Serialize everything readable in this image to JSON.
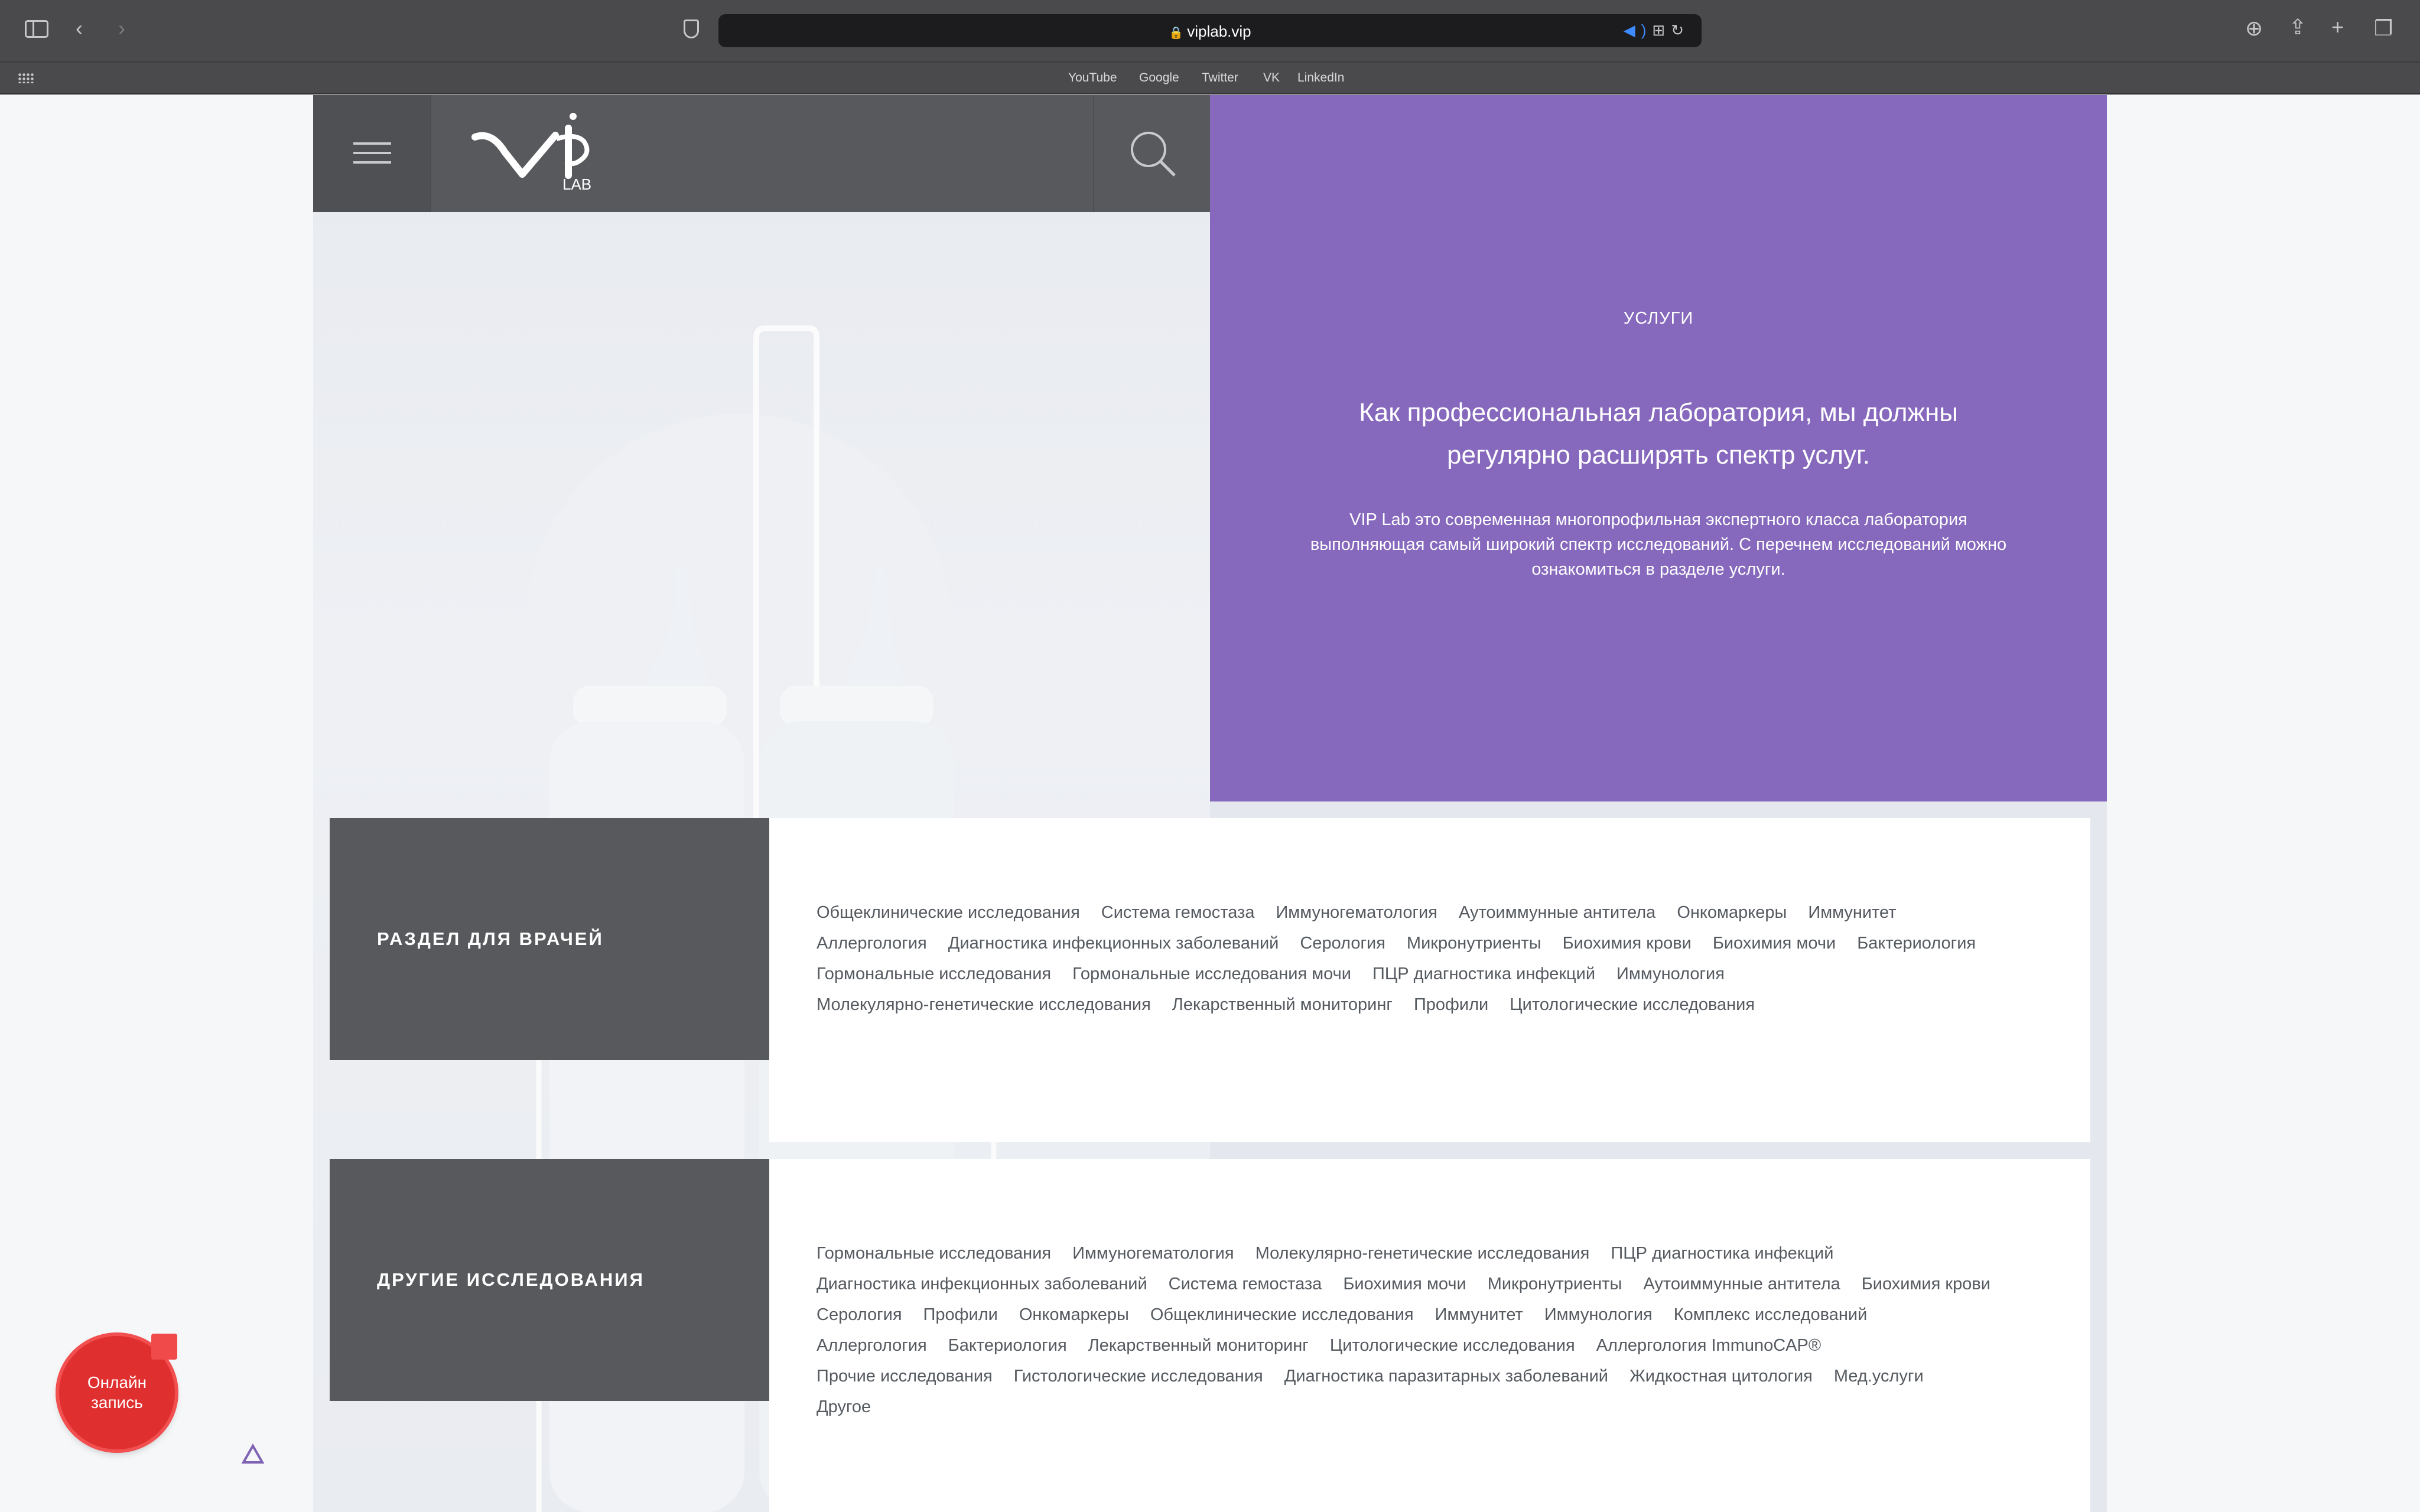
{
  "browser": {
    "url": "viplab.vip",
    "favorites": [
      "YouTube",
      "Google",
      "Twitter",
      "VK",
      "LinkedIn"
    ]
  },
  "header": {
    "logo_sub": "LAB"
  },
  "hero": {
    "label": "УСЛУГИ",
    "heading": "Как профессиональная лаборатория, мы должны регулярно расширять спектр услуг.",
    "body": "VIP Lab это современная многопрофильная экспертного класса лаборатория выполняющая самый широкий спектр исследований. С перечнем исследований можно ознакомиться в разделе услуги."
  },
  "sections": [
    {
      "title": "РАЗДЕЛ ДЛЯ ВРАЧЕЙ",
      "links": [
        "Общеклинические исследования",
        "Система гемостаза",
        "Иммуногематология",
        "Аутоиммунные антитела",
        "Онкомаркеры",
        "Иммунитет",
        "Аллергология",
        "Диагностика инфекционных заболеваний",
        "Серология",
        "Микронутриенты",
        "Биохимия крови",
        "Биохимия мочи",
        "Бактериология",
        "Гормональные исследования",
        "Гормональные исследования мочи",
        "ПЦР диагностика инфекций",
        "Иммунология",
        "Молекулярно-генетические исследования",
        "Лекарственный мониторинг",
        "Профили",
        "Цитологические исследования"
      ]
    },
    {
      "title": "ДРУГИЕ ИССЛЕДОВАНИЯ",
      "links": [
        "Гормональные исследования",
        "Иммуногематология",
        "Молекулярно-генетические исследования",
        "ПЦР диагностика инфекций",
        "Диагностика инфекционных заболеваний",
        "Система гемостаза",
        "Биохимия мочи",
        "Микронутриенты",
        "Аутоиммунные антитела",
        "Биохимия крови",
        "Серология",
        "Профили",
        "Онкомаркеры",
        "Общеклинические исследования",
        "Иммунитет",
        "Иммунология",
        "Комплекс исследований",
        "Аллергология",
        "Бактериология",
        "Лекарственный мониторинг",
        "Цитологические исследования",
        "Аллергология ImmunoCAP®",
        "Прочие исследования",
        "Гистологические исследования",
        "Диагностика паразитарных заболеваний",
        "Жидкостная цитология",
        "Мед.услуги",
        "Другое"
      ]
    }
  ],
  "booking": {
    "line1": "Онлайн",
    "line2": "запись"
  },
  "colors": {
    "accent_purple": "#8669bd",
    "header_gray": "#57595d",
    "booking_red": "#e02f2f"
  }
}
